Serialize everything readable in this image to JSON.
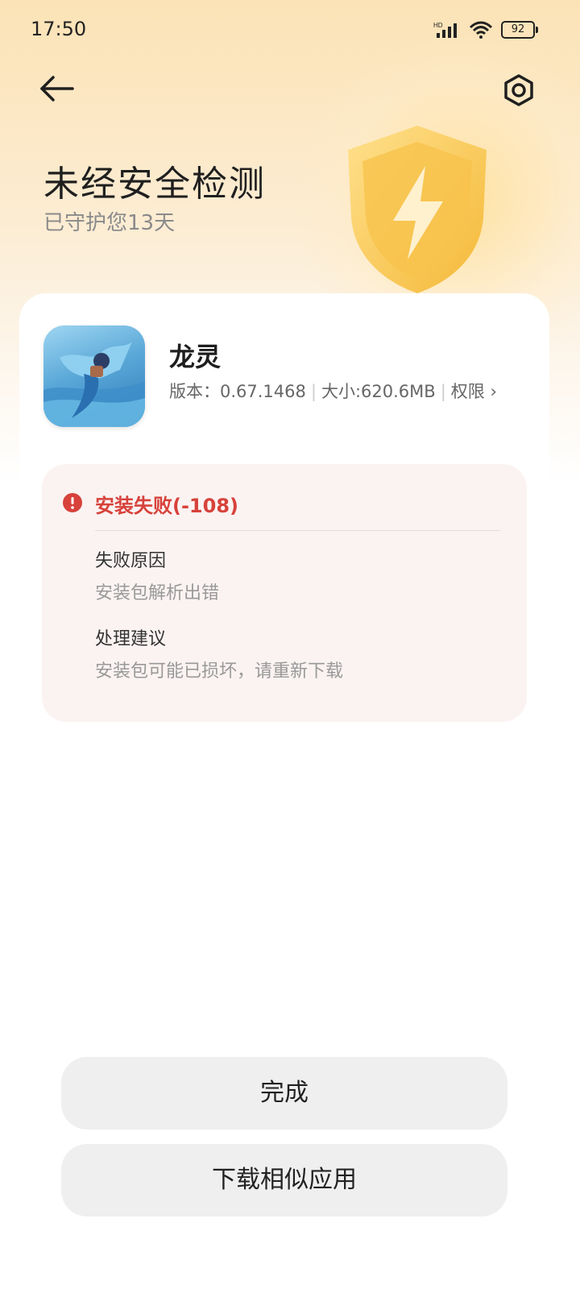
{
  "status_bar": {
    "time": "17:50",
    "network_label": "HD",
    "battery": "92"
  },
  "header": {
    "back_icon": "arrow-left-icon",
    "settings_icon": "gear-icon"
  },
  "hero": {
    "title": "未经安全检测",
    "subtitle": "已守护您13天"
  },
  "app": {
    "name": "龙灵",
    "version_label": "版本：0.67.1468",
    "size_label": "大小:620.6MB",
    "permissions_label": "权限",
    "chevron": "›"
  },
  "failure": {
    "title": "安装失败(-108)",
    "reason_label": "失败原因",
    "reason_text": "安装包解析出错",
    "advice_label": "处理建议",
    "advice_text": "安装包可能已损坏，请重新下载"
  },
  "buttons": {
    "done": "完成",
    "download_similar": "下载相似应用"
  },
  "colors": {
    "accent_error": "#d7423b",
    "hero_gradient_top": "#fbe3b6",
    "button_bg": "#efefef"
  }
}
